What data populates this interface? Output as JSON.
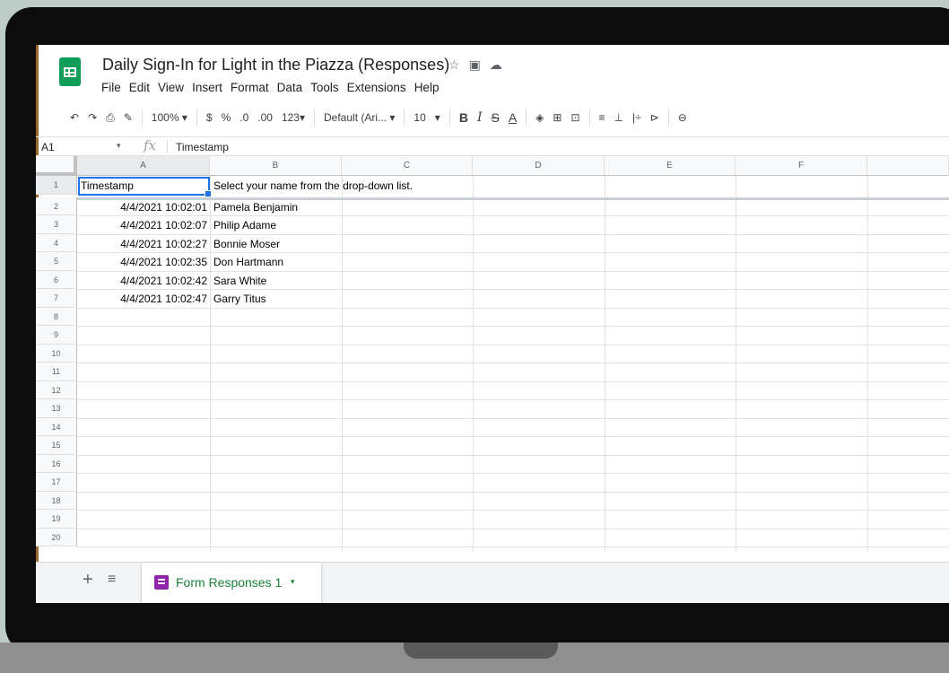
{
  "document": {
    "title": "Daily Sign-In for Light in the Piazza (Responses)",
    "icons": [
      "star-icon",
      "folder-move-icon",
      "cloud-status-icon"
    ]
  },
  "menu": [
    "File",
    "Edit",
    "View",
    "Insert",
    "Format",
    "Data",
    "Tools",
    "Extensions",
    "Help"
  ],
  "toolbar": {
    "undo": "↶",
    "redo": "↷",
    "print": "⎙",
    "paint_format": "✎",
    "zoom": "100%",
    "zoom_caret": "▾",
    "currency": "$",
    "percent": "%",
    "decrease_decimal": ".0",
    "increase_decimal": ".00",
    "more_formats": "123",
    "more_formats_caret": "▾",
    "font": "Default (Ari...",
    "font_caret": "▾",
    "font_size": "10",
    "font_size_caret": "▾",
    "bold": "B",
    "italic": "I",
    "strikethrough": "S",
    "text_color": "A",
    "fill_color": "◈",
    "borders": "⊞",
    "merge": "⊡",
    "align": "≡",
    "valign": "⊥",
    "wrap": "|÷",
    "rotate": "⊳",
    "link": "⊖"
  },
  "formula_bar": {
    "name_box": "A1",
    "name_box_caret": "▾",
    "fx": "fx",
    "value": "Timestamp"
  },
  "sheet": {
    "columns": [
      "A",
      "B",
      "C",
      "D",
      "E",
      "F"
    ],
    "row_numbers": [
      "1",
      "2",
      "3",
      "4",
      "5",
      "6",
      "7",
      "8",
      "9",
      "10",
      "11",
      "12",
      "13",
      "14",
      "15",
      "16",
      "17",
      "18",
      "19",
      "20"
    ],
    "header_row": [
      "Timestamp",
      "Select your name from the drop-down list."
    ],
    "rows": [
      [
        "4/4/2021 10:02:01",
        "Pamela Benjamin"
      ],
      [
        "4/4/2021 10:02:07",
        "Philip Adame"
      ],
      [
        "4/4/2021 10:02:27",
        "Bonnie Moser"
      ],
      [
        "4/4/2021 10:02:35",
        "Don Hartmann"
      ],
      [
        "4/4/2021 10:02:42",
        "Sara White"
      ],
      [
        "4/4/2021 10:02:47",
        "Garry Titus"
      ]
    ],
    "selected_cell": "A1"
  },
  "tabs": {
    "add": "+",
    "all_sheets": "≡",
    "active_tab": "Form Responses 1",
    "active_tab_caret": "▾"
  },
  "colors": {
    "sheets_green": "#0f9d58",
    "selection_blue": "#1a73e8",
    "tab_text_green": "#188038",
    "form_icon_purple": "#8e24aa"
  }
}
